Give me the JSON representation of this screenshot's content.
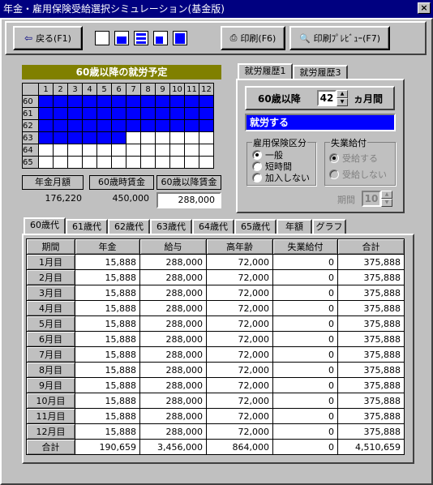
{
  "window": {
    "title": "年金・雇用保険受給選択シミュレーション(基金版)",
    "close": "×"
  },
  "toolbar": {
    "back": "戻る(F1)",
    "print": "印刷(F6)",
    "preview": "印刷ﾌﾟﾚﾋﾞｭｰ(F7)"
  },
  "schedule": {
    "title": "60歳以降の就労予定",
    "months": [
      "1",
      "2",
      "3",
      "4",
      "5",
      "6",
      "7",
      "8",
      "9",
      "10",
      "11",
      "12"
    ],
    "ages": [
      "60",
      "61",
      "62",
      "63",
      "64",
      "65"
    ],
    "filled_months": [
      12,
      12,
      12,
      6,
      0,
      0
    ]
  },
  "summary": {
    "labels": [
      "年金月額",
      "60歳時賃金",
      "60歳以降賃金"
    ],
    "values": [
      "176,220",
      "450,000",
      "288,000"
    ]
  },
  "history_tabs": [
    "就労履歴1",
    "就労履歴3"
  ],
  "work": {
    "age_label": "60歳以降",
    "months": "42",
    "months_unit": "ヵ月間",
    "status": "就労する"
  },
  "insurance": {
    "title": "雇用保険区分",
    "options": [
      "一般",
      "短時間",
      "加入しない"
    ],
    "selected": 0
  },
  "unemployment": {
    "title": "失業給付",
    "options": [
      "受給する",
      "受給しない"
    ]
  },
  "period": {
    "label": "期間",
    "value": "10"
  },
  "result_tabs": [
    "60歳代",
    "61歳代",
    "62歳代",
    "63歳代",
    "64歳代",
    "65歳代",
    "年額",
    "グラフ"
  ],
  "table": {
    "headers": [
      "期間",
      "年金",
      "給与",
      "高年齢",
      "失業給付",
      "合計"
    ],
    "rows": [
      [
        "1月目",
        "15,888",
        "288,000",
        "72,000",
        "0",
        "375,888"
      ],
      [
        "2月目",
        "15,888",
        "288,000",
        "72,000",
        "0",
        "375,888"
      ],
      [
        "3月目",
        "15,888",
        "288,000",
        "72,000",
        "0",
        "375,888"
      ],
      [
        "4月目",
        "15,888",
        "288,000",
        "72,000",
        "0",
        "375,888"
      ],
      [
        "5月目",
        "15,888",
        "288,000",
        "72,000",
        "0",
        "375,888"
      ],
      [
        "6月目",
        "15,888",
        "288,000",
        "72,000",
        "0",
        "375,888"
      ],
      [
        "7月目",
        "15,888",
        "288,000",
        "72,000",
        "0",
        "375,888"
      ],
      [
        "8月目",
        "15,888",
        "288,000",
        "72,000",
        "0",
        "375,888"
      ],
      [
        "9月目",
        "15,888",
        "288,000",
        "72,000",
        "0",
        "375,888"
      ],
      [
        "10月目",
        "15,888",
        "288,000",
        "72,000",
        "0",
        "375,888"
      ],
      [
        "11月目",
        "15,888",
        "288,000",
        "72,000",
        "0",
        "375,888"
      ],
      [
        "12月目",
        "15,888",
        "288,000",
        "72,000",
        "0",
        "375,888"
      ],
      [
        "合計",
        "190,659",
        "3,456,000",
        "864,000",
        "0",
        "4,510,659"
      ]
    ]
  },
  "colors": {
    "accent": "#0000ff",
    "title_bar": "#000080",
    "schedule_header": "#808000"
  }
}
